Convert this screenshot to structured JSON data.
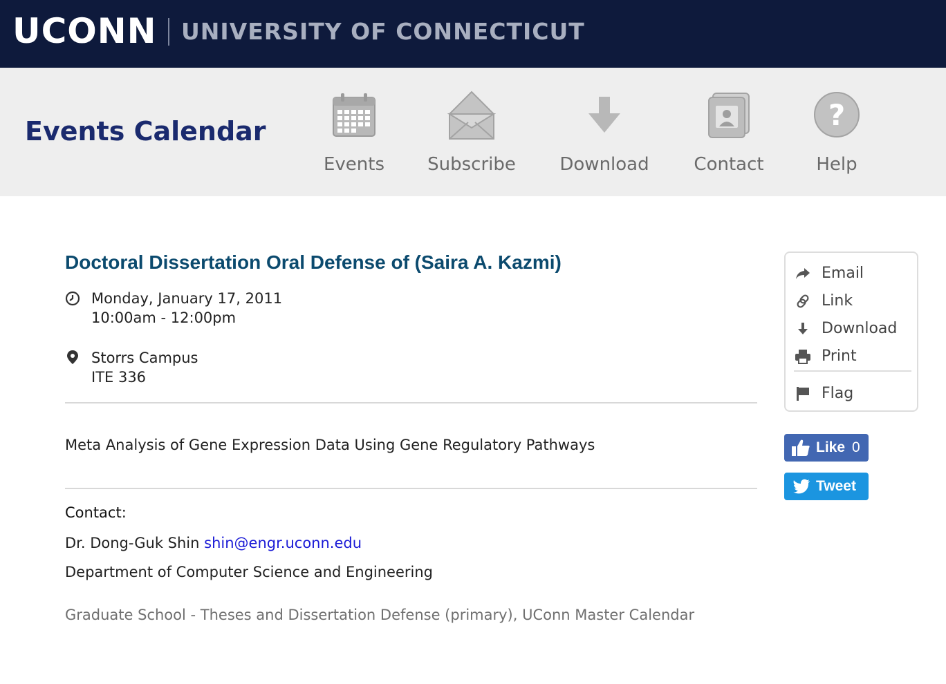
{
  "brand": {
    "logo_text": "UCONN",
    "university_name": "UNIVERSITY OF CONNECTICUT",
    "colors": {
      "navy": "#0e1a3c",
      "title_blue": "#1a2a6e",
      "event_title": "#0b4a6e",
      "link": "#1a1ad6"
    }
  },
  "header": {
    "title": "Events Calendar",
    "nav": [
      {
        "label": "Events",
        "icon": "calendar-icon"
      },
      {
        "label": "Subscribe",
        "icon": "envelope-icon"
      },
      {
        "label": "Download",
        "icon": "download-arrow-icon"
      },
      {
        "label": "Contact",
        "icon": "contact-card-icon"
      },
      {
        "label": "Help",
        "icon": "help-icon"
      }
    ]
  },
  "event": {
    "title": "Doctoral Dissertation Oral Defense of (Saira A. Kazmi)",
    "date": "Monday, January 17, 2011",
    "time": "10:00am - 12:00pm",
    "location_campus": "Storrs Campus",
    "location_room": "ITE 336",
    "description": "Meta Analysis of Gene Expression Data Using Gene Regulatory Pathways",
    "contact_label": "Contact:",
    "contact_name": "Dr. Dong-Guk Shin",
    "contact_email": "shin@engr.uconn.edu",
    "department": "Department of Computer Science and Engineering",
    "calendars": "Graduate School - Theses and Dissertation Defense (primary), UConn Master Calendar"
  },
  "tools": {
    "items": [
      {
        "label": "Email",
        "icon": "share-arrow-icon"
      },
      {
        "label": "Link",
        "icon": "link-icon"
      },
      {
        "label": "Download",
        "icon": "download-icon"
      },
      {
        "label": "Print",
        "icon": "print-icon"
      },
      {
        "label": "Flag",
        "icon": "flag-icon"
      }
    ]
  },
  "social": {
    "like_label": "Like",
    "like_count": "0",
    "tweet_label": "Tweet"
  }
}
